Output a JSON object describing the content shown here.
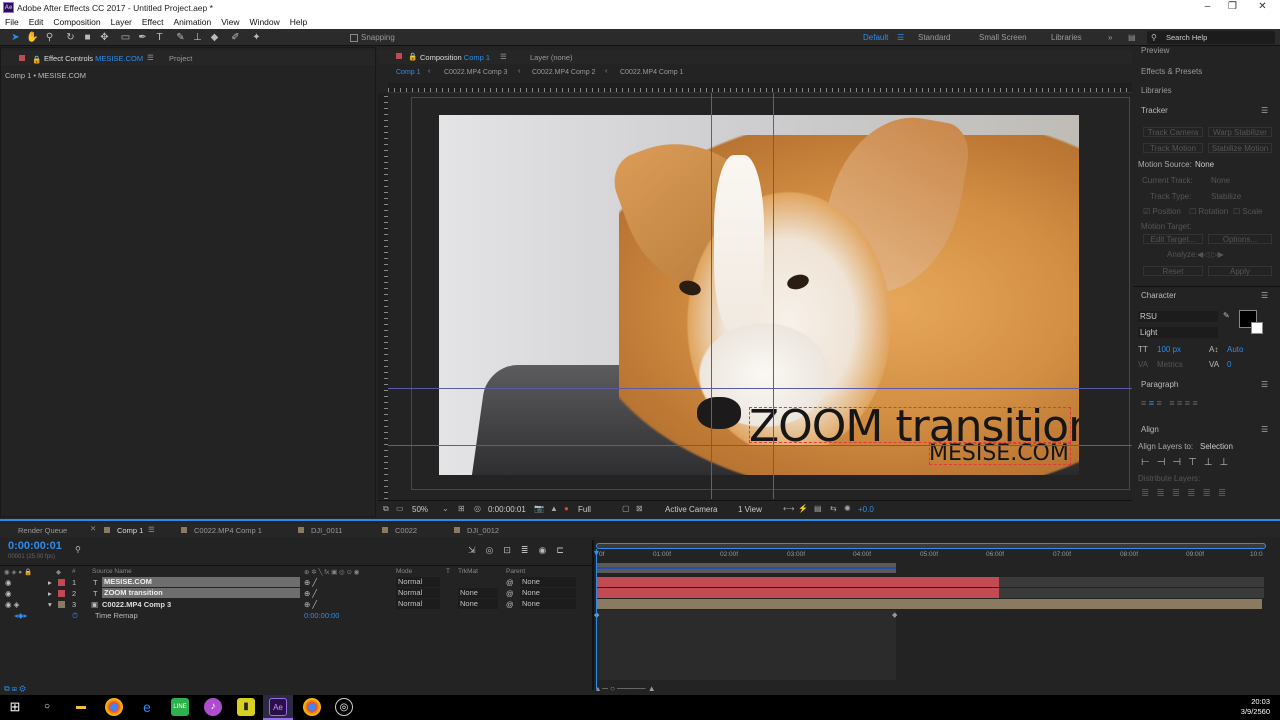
{
  "app": {
    "title": "Adobe After Effects CC 2017 - Untitled Project.aep *",
    "logo_text": "Ae"
  },
  "menu": [
    "File",
    "Edit",
    "Composition",
    "Layer",
    "Effect",
    "Animation",
    "View",
    "Window",
    "Help"
  ],
  "toolbar": {
    "snapping_label": "Snapping",
    "workspaces": [
      "Default",
      "Standard",
      "Small Screen",
      "Libraries"
    ],
    "search_placeholder": "Search Help"
  },
  "left_panel": {
    "tab_effect_controls": "Effect Controls",
    "tab_effect_controls_target": "MESISE.COM",
    "tab_project": "Project",
    "breadcrumb": "Comp 1 • MESISE.COM"
  },
  "viewer": {
    "tab_composition": "Composition",
    "tab_composition_target": "Comp 1",
    "tab_layer": "Layer (none)",
    "flow": [
      "Comp 1",
      "C0022.MP4 Comp 3",
      "C0022.MP4 Comp 2",
      "C0022.MP4 Comp 1"
    ],
    "zoom": "50%",
    "timecode": "0:00:00:01",
    "resolution": "Full",
    "camera": "Active Camera",
    "views": "1 View",
    "exposure": "+0.0",
    "overlay_title": "ZOOM transition",
    "overlay_sub": "MESISE.COM"
  },
  "right_panel": {
    "preview": "Preview",
    "effects_presets": "Effects & Presets",
    "libraries": "Libraries",
    "tracker": "Tracker",
    "track_camera": "Track Camera",
    "warp_stabilizer": "Warp Stabilizer",
    "track_motion": "Track Motion",
    "stabilize_motion": "Stabilize Motion",
    "motion_source_label": "Motion Source:",
    "motion_source_value": "None",
    "current_track": "Current Track:",
    "current_track_value": "None",
    "track_type": "Track Type:",
    "track_type_value": "Stabilize",
    "position": "Position",
    "rotation": "Rotation",
    "scale": "Scale",
    "motion_target": "Motion Target:",
    "edit_target": "Edit Target...",
    "options": "Options...",
    "analyze": "Analyze:",
    "reset": "Reset",
    "apply": "Apply",
    "character": "Character",
    "font_name": "RSU",
    "font_style": "Light",
    "font_size": "100 px",
    "leading": "Auto",
    "kerning": "Metrics",
    "tracking": "0",
    "paragraph": "Paragraph",
    "align": "Align",
    "align_layers_to": "Align Layers to:",
    "align_layers_value": "Selection",
    "distribute_layers": "Distribute Layers:"
  },
  "timeline": {
    "tabs": [
      "Render Queue",
      "Comp 1",
      "C0022.MP4 Comp 1",
      "DJI_0011",
      "C0022",
      "DJI_0012"
    ],
    "timecode": "0:00:00:01",
    "frames": "00001 (25.00 fps)",
    "columns": {
      "source_name": "Source Name",
      "mode": "Mode",
      "trkmat": "TrkMat",
      "parent": "Parent"
    },
    "ruler": [
      "0f",
      "01:00f",
      "02:00f",
      "03:00f",
      "04:00f",
      "05:00f",
      "06:00f",
      "07:00f",
      "08:00f",
      "09:00f",
      "10:0"
    ],
    "layers": [
      {
        "num": "1",
        "type": "T",
        "name": "MESISE.COM",
        "mode": "Normal",
        "trkmat": "",
        "parent": "None"
      },
      {
        "num": "2",
        "type": "T",
        "name": "ZOOM transition",
        "mode": "Normal",
        "trkmat": "None",
        "parent": "None"
      },
      {
        "num": "3",
        "type": "▣",
        "name": "C0022.MP4 Comp 3",
        "mode": "Normal",
        "trkmat": "None",
        "parent": "None"
      }
    ],
    "property": {
      "name": "Time Remap",
      "value": "0:00:00:00"
    }
  },
  "taskbar": {
    "time": "20:03",
    "date": "3/9/2560"
  },
  "colors": {
    "accent": "#2d8ceb",
    "layer_bar_red": "#c24a52",
    "layer_bar_tan": "#8a7a62"
  }
}
